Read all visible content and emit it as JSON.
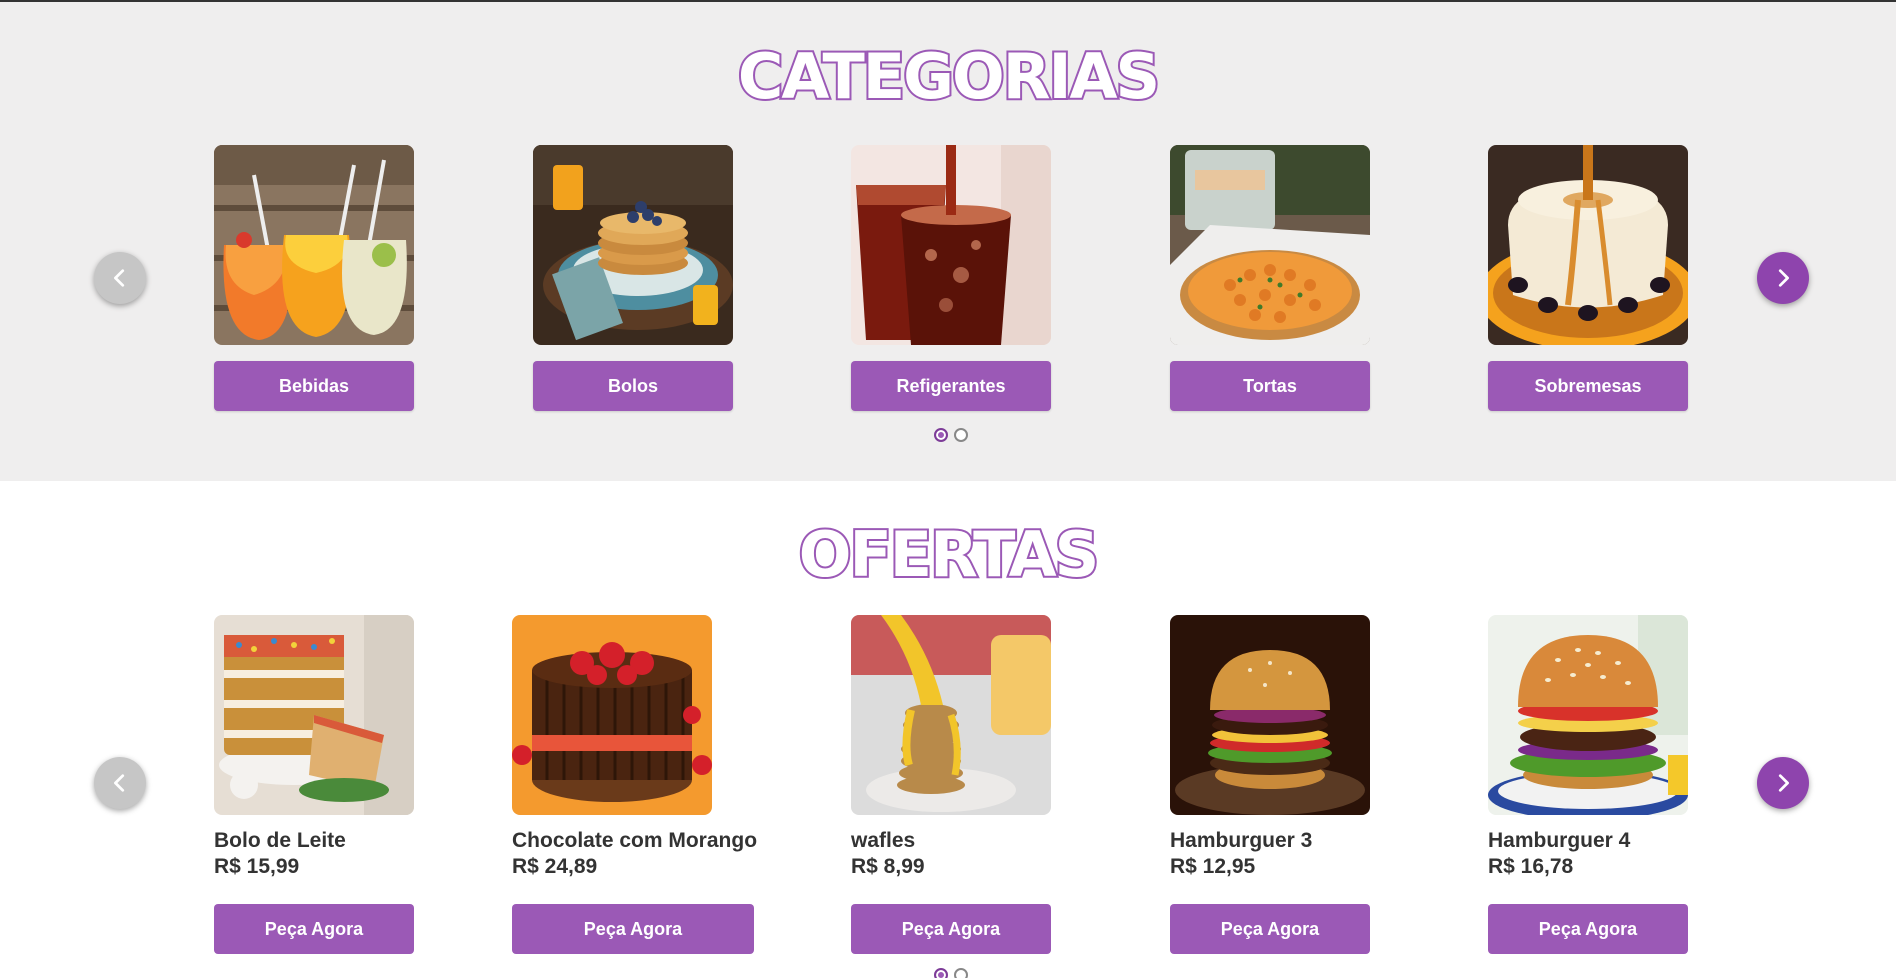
{
  "categories": {
    "title": "CATEGORIAS",
    "prev_icon": "chevron-left-icon",
    "next_icon": "chevron-right-icon",
    "items": [
      {
        "label": "Bebidas"
      },
      {
        "label": "Bolos"
      },
      {
        "label": "Refigerantes"
      },
      {
        "label": "Tortas"
      },
      {
        "label": "Sobremesas"
      }
    ],
    "pages": 2,
    "active_page": 1
  },
  "offers": {
    "title": "OFERTAS",
    "prev_icon": "chevron-left-icon",
    "next_icon": "chevron-right-icon",
    "items": [
      {
        "name": "Bolo de Leite",
        "price": "R$ 15,99",
        "button": "Peça Agora"
      },
      {
        "name": "Chocolate com Morango",
        "price": "R$ 24,89",
        "button": "Peça Agora"
      },
      {
        "name": "wafles",
        "price": "R$ 8,99",
        "button": "Peça Agora"
      },
      {
        "name": "Hamburguer 3",
        "price": "R$ 12,95",
        "button": "Peça Agora"
      },
      {
        "name": "Hamburguer 4",
        "price": "R$ 16,78",
        "button": "Peça Agora"
      }
    ],
    "pages": 2,
    "active_page": 1
  },
  "colors": {
    "accent": "#9b59b6",
    "accent_dark": "#8e44ad",
    "section_bg": "#efeeee",
    "arrow_disabled": "#c6c6c6"
  }
}
